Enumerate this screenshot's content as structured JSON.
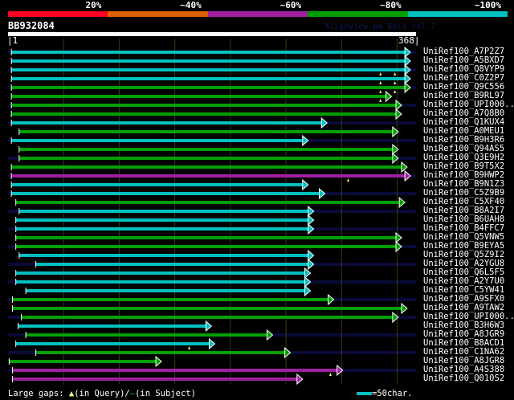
{
  "coverage_legend": [
    {
      "label": "20%",
      "color": "#ff0022"
    },
    {
      "label": "~40%",
      "color": "#e06000"
    },
    {
      "label": "~60%",
      "color": "#a020a0"
    },
    {
      "label": "~80%",
      "color": "#00a000"
    },
    {
      "label": "~100%",
      "color": "#00c0c0"
    }
  ],
  "query": {
    "name": "BB932084",
    "start": "1",
    "end": "368",
    "length": 368
  },
  "watermark": "AlignView.pm Beta rel.7",
  "grid_step": 50,
  "hits": [
    {
      "name": "UniRef100_A7P2Z7",
      "color": "cyan",
      "start": 4,
      "end": 363,
      "gaps": []
    },
    {
      "name": "UniRef100_A5BXD7",
      "color": "cyan",
      "start": 4,
      "end": 363,
      "gaps": []
    },
    {
      "name": "UniRef100_Q8VYP9",
      "color": "cyan",
      "start": 4,
      "end": 363,
      "gaps": [
        336,
        349
      ]
    },
    {
      "name": "UniRef100_C0Z2P7",
      "color": "cyan",
      "start": 4,
      "end": 363,
      "gaps": [
        336,
        349
      ]
    },
    {
      "name": "UniRef100_Q9C556",
      "color": "green",
      "start": 4,
      "end": 363,
      "gaps": [
        336,
        349
      ]
    },
    {
      "name": "UniRef100_B9RL97",
      "color": "green",
      "start": 4,
      "end": 346,
      "gaps": [
        336
      ]
    },
    {
      "name": "UniRef100_UPI000..",
      "color": "green",
      "start": 4,
      "end": 355,
      "gaps": []
    },
    {
      "name": "UniRef100_A7Q8B0",
      "color": "green",
      "start": 4,
      "end": 355,
      "gaps": []
    },
    {
      "name": "UniRef100_Q1KUX4",
      "color": "cyan",
      "start": 4,
      "end": 288,
      "gaps": []
    },
    {
      "name": "UniRef100_A0MEU1",
      "color": "green",
      "start": 11,
      "end": 352,
      "gaps": []
    },
    {
      "name": "UniRef100_B9H3R6",
      "color": "cyan",
      "start": 4,
      "end": 271,
      "gaps": []
    },
    {
      "name": "UniRef100_Q94AS5",
      "color": "green",
      "start": 11,
      "end": 352,
      "gaps": []
    },
    {
      "name": "UniRef100_Q3E9H2",
      "color": "green",
      "start": 11,
      "end": 352,
      "gaps": []
    },
    {
      "name": "UniRef100_B9T5X2",
      "color": "green",
      "start": 4,
      "end": 360,
      "gaps": []
    },
    {
      "name": "UniRef100_B9HWP2",
      "color": "purple",
      "start": 4,
      "end": 363,
      "gaps": [
        307
      ]
    },
    {
      "name": "UniRef100_B9N1Z3",
      "color": "cyan",
      "start": 4,
      "end": 271,
      "gaps": []
    },
    {
      "name": "UniRef100_C5Z9B9",
      "color": "cyan",
      "start": 4,
      "end": 286,
      "gaps": []
    },
    {
      "name": "UniRef100_C5XF40",
      "color": "green",
      "start": 8,
      "end": 358,
      "gaps": []
    },
    {
      "name": "UniRef100_B8A2I7",
      "color": "cyan",
      "start": 11,
      "end": 276,
      "gaps": []
    },
    {
      "name": "UniRef100_B6UAH8",
      "color": "cyan",
      "start": 8,
      "end": 276,
      "gaps": []
    },
    {
      "name": "UniRef100_B4FFC7",
      "color": "cyan",
      "start": 8,
      "end": 276,
      "gaps": []
    },
    {
      "name": "UniRef100_Q5VNW5",
      "color": "green",
      "start": 8,
      "end": 355,
      "gaps": []
    },
    {
      "name": "UniRef100_B9EYA5",
      "color": "green",
      "start": 8,
      "end": 355,
      "gaps": []
    },
    {
      "name": "UniRef100_Q5Z9I2",
      "color": "cyan",
      "start": 11,
      "end": 276,
      "gaps": []
    },
    {
      "name": "UniRef100_A2YGU8",
      "color": "cyan",
      "start": 26,
      "end": 276,
      "gaps": []
    },
    {
      "name": "UniRef100_Q6L5F5",
      "color": "cyan",
      "start": 8,
      "end": 273,
      "gaps": []
    },
    {
      "name": "UniRef100_A2Y7U0",
      "color": "cyan",
      "start": 8,
      "end": 273,
      "gaps": []
    },
    {
      "name": "UniRef100_C5YW41",
      "color": "cyan",
      "start": 17,
      "end": 273,
      "gaps": []
    },
    {
      "name": "UniRef100_A9SFX0",
      "color": "green",
      "start": 5,
      "end": 294,
      "gaps": []
    },
    {
      "name": "UniRef100_A9TAW2",
      "color": "green",
      "start": 5,
      "end": 360,
      "gaps": []
    },
    {
      "name": "UniRef100_UPI000..",
      "color": "green",
      "start": 13,
      "end": 352,
      "gaps": []
    },
    {
      "name": "UniRef100_B3H6W3",
      "color": "cyan",
      "start": 10,
      "end": 184,
      "gaps": []
    },
    {
      "name": "UniRef100_A8JGR9",
      "color": "green",
      "start": 17,
      "end": 239,
      "gaps": []
    },
    {
      "name": "UniRef100_B8ACD1",
      "color": "cyan",
      "start": 8,
      "end": 187,
      "gaps": [
        164
      ]
    },
    {
      "name": "UniRef100_C1NA62",
      "color": "green",
      "start": 26,
      "end": 255,
      "gaps": []
    },
    {
      "name": "UniRef100_A8JGR8",
      "color": "green",
      "start": 2,
      "end": 139,
      "gaps": []
    },
    {
      "name": "UniRef100_A4S388",
      "color": "purple",
      "start": 5,
      "end": 302,
      "gaps": [
        291
      ]
    },
    {
      "name": "UniRef100_Q010S2",
      "color": "purple",
      "start": 5,
      "end": 266,
      "gaps": []
    }
  ],
  "colors": {
    "cyan": "#00c0c0",
    "green": "#00a000",
    "purple": "#a020a0",
    "stripe": "#0a0a38",
    "grid": "#3a3a10",
    "gap": "#ffff80"
  },
  "legend": {
    "prefix": "Large gaps:",
    "query_text": "(in Query)/",
    "subject_text": "(in Subject)",
    "scale_text": "=50char."
  }
}
